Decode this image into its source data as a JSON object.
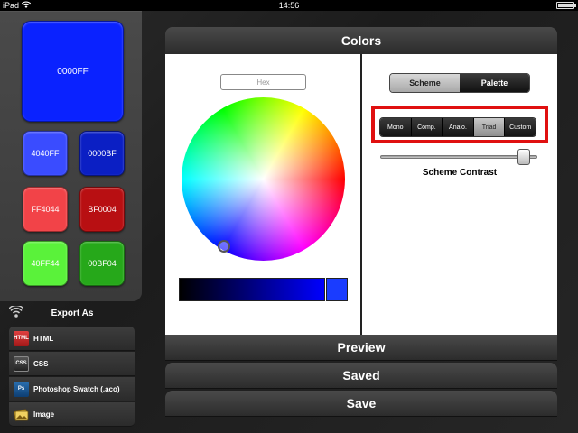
{
  "status_bar": {
    "carrier": "iPad",
    "time": "14:56"
  },
  "swatches": {
    "main": {
      "label": "0000FF",
      "color": "#0a22ff"
    },
    "items": [
      {
        "label": "4040FF",
        "color": "#3a4cff"
      },
      {
        "label": "0000BF",
        "color": "#0b1fc4"
      },
      {
        "label": "FF4044",
        "color": "#f24348"
      },
      {
        "label": "BF0004",
        "color": "#b80f12"
      },
      {
        "label": "40FF44",
        "color": "#5af23a"
      },
      {
        "label": "00BF04",
        "color": "#26a81a"
      }
    ]
  },
  "export": {
    "title": "Export As",
    "items": [
      {
        "label": "HTML",
        "icon": "html-file-icon",
        "icon_text": "HTML"
      },
      {
        "label": "CSS",
        "icon": "css-file-icon",
        "icon_text": "CSS"
      },
      {
        "label": "Photoshop Swatch (.aco)",
        "icon": "photoshop-icon",
        "icon_text": "Ps"
      },
      {
        "label": "Image",
        "icon": "image-icon",
        "icon_text": ""
      }
    ]
  },
  "colors_panel": {
    "title": "Colors",
    "hex_placeholder": "Hex",
    "preview_color": "#1a3cff"
  },
  "scheme_panel": {
    "mode_tabs": [
      {
        "label": "Scheme",
        "active": true
      },
      {
        "label": "Palette",
        "active": false
      }
    ],
    "scheme_types": [
      "Mono",
      "Comp.",
      "Analo.",
      "Triad",
      "Custom"
    ],
    "active_scheme": "Triad",
    "slider_label": "Scheme Contrast",
    "slider_value": 0.95
  },
  "bottom_bars": {
    "preview": "Preview",
    "saved": "Saved",
    "save": "Save"
  },
  "colors": {
    "highlight": "#e01010"
  }
}
